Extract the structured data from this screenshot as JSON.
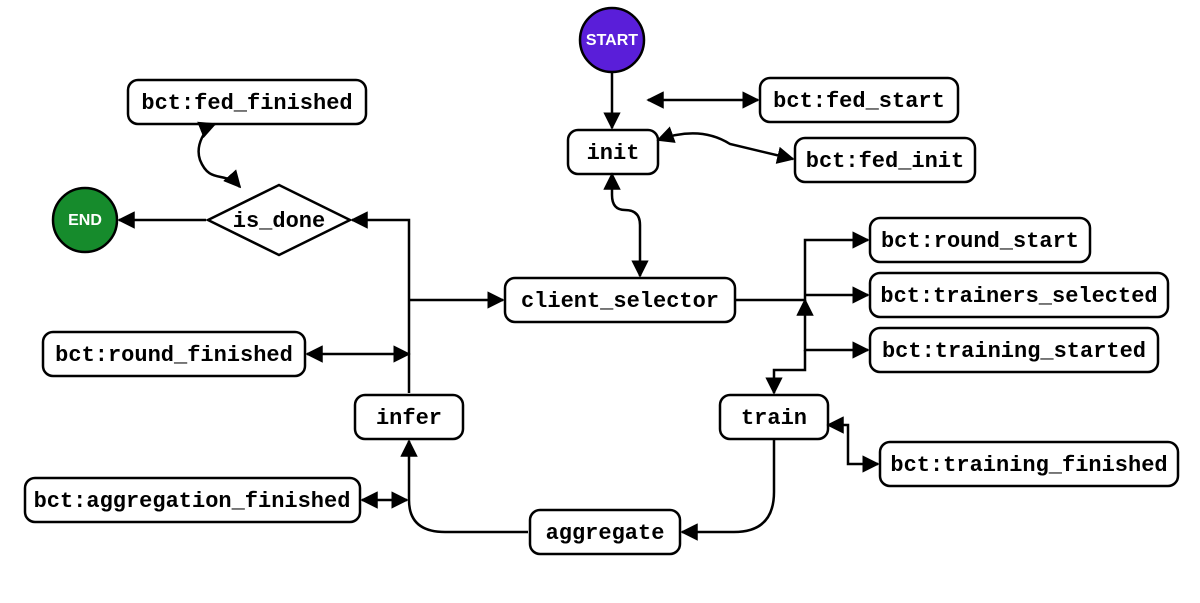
{
  "nodes": {
    "start": "START",
    "end": "END",
    "init": "init",
    "is_done": "is_done",
    "client_selector": "client_selector",
    "infer": "infer",
    "train": "train",
    "aggregate": "aggregate"
  },
  "events": {
    "fed_finished": "bct:fed_finished",
    "fed_start": "bct:fed_start",
    "fed_init": "bct:fed_init",
    "round_start": "bct:round_start",
    "trainers_selected": "bct:trainers_selected",
    "training_started": "bct:training_started",
    "round_finished": "bct:round_finished",
    "training_finished": "bct:training_finished",
    "aggregation_finished": "bct:aggregation_finished"
  }
}
